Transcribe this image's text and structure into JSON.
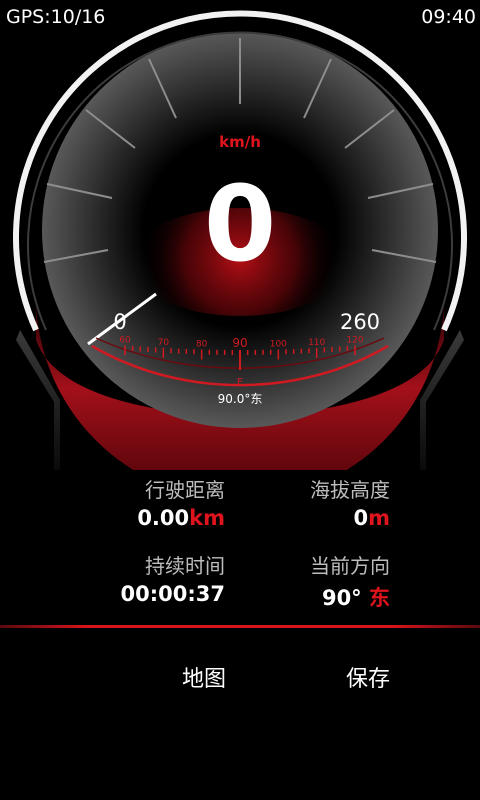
{
  "status_bar": {
    "gps": "GPS:10/16",
    "time": "09:40"
  },
  "speedometer": {
    "unit": "km/h",
    "speed": "0",
    "min_label": "0",
    "max_label": "260",
    "compass_ticks": [
      "60",
      "70",
      "80",
      "90",
      "100",
      "110",
      "120"
    ],
    "compass_marker": "E",
    "heading_readout": "90.0°东"
  },
  "stats": {
    "distance": {
      "label": "行驶距离",
      "value": "0.00",
      "unit": "km"
    },
    "altitude": {
      "label": "海拔高度",
      "value": "0",
      "unit": "m"
    },
    "duration": {
      "label": "持续时间",
      "value": "00:00:37"
    },
    "heading": {
      "label": "当前方向",
      "value": "90°",
      "unit": "东"
    }
  },
  "actions": {
    "map": "地图",
    "save": "保存"
  },
  "colors": {
    "accent": "#e0141c",
    "background": "#000000"
  }
}
